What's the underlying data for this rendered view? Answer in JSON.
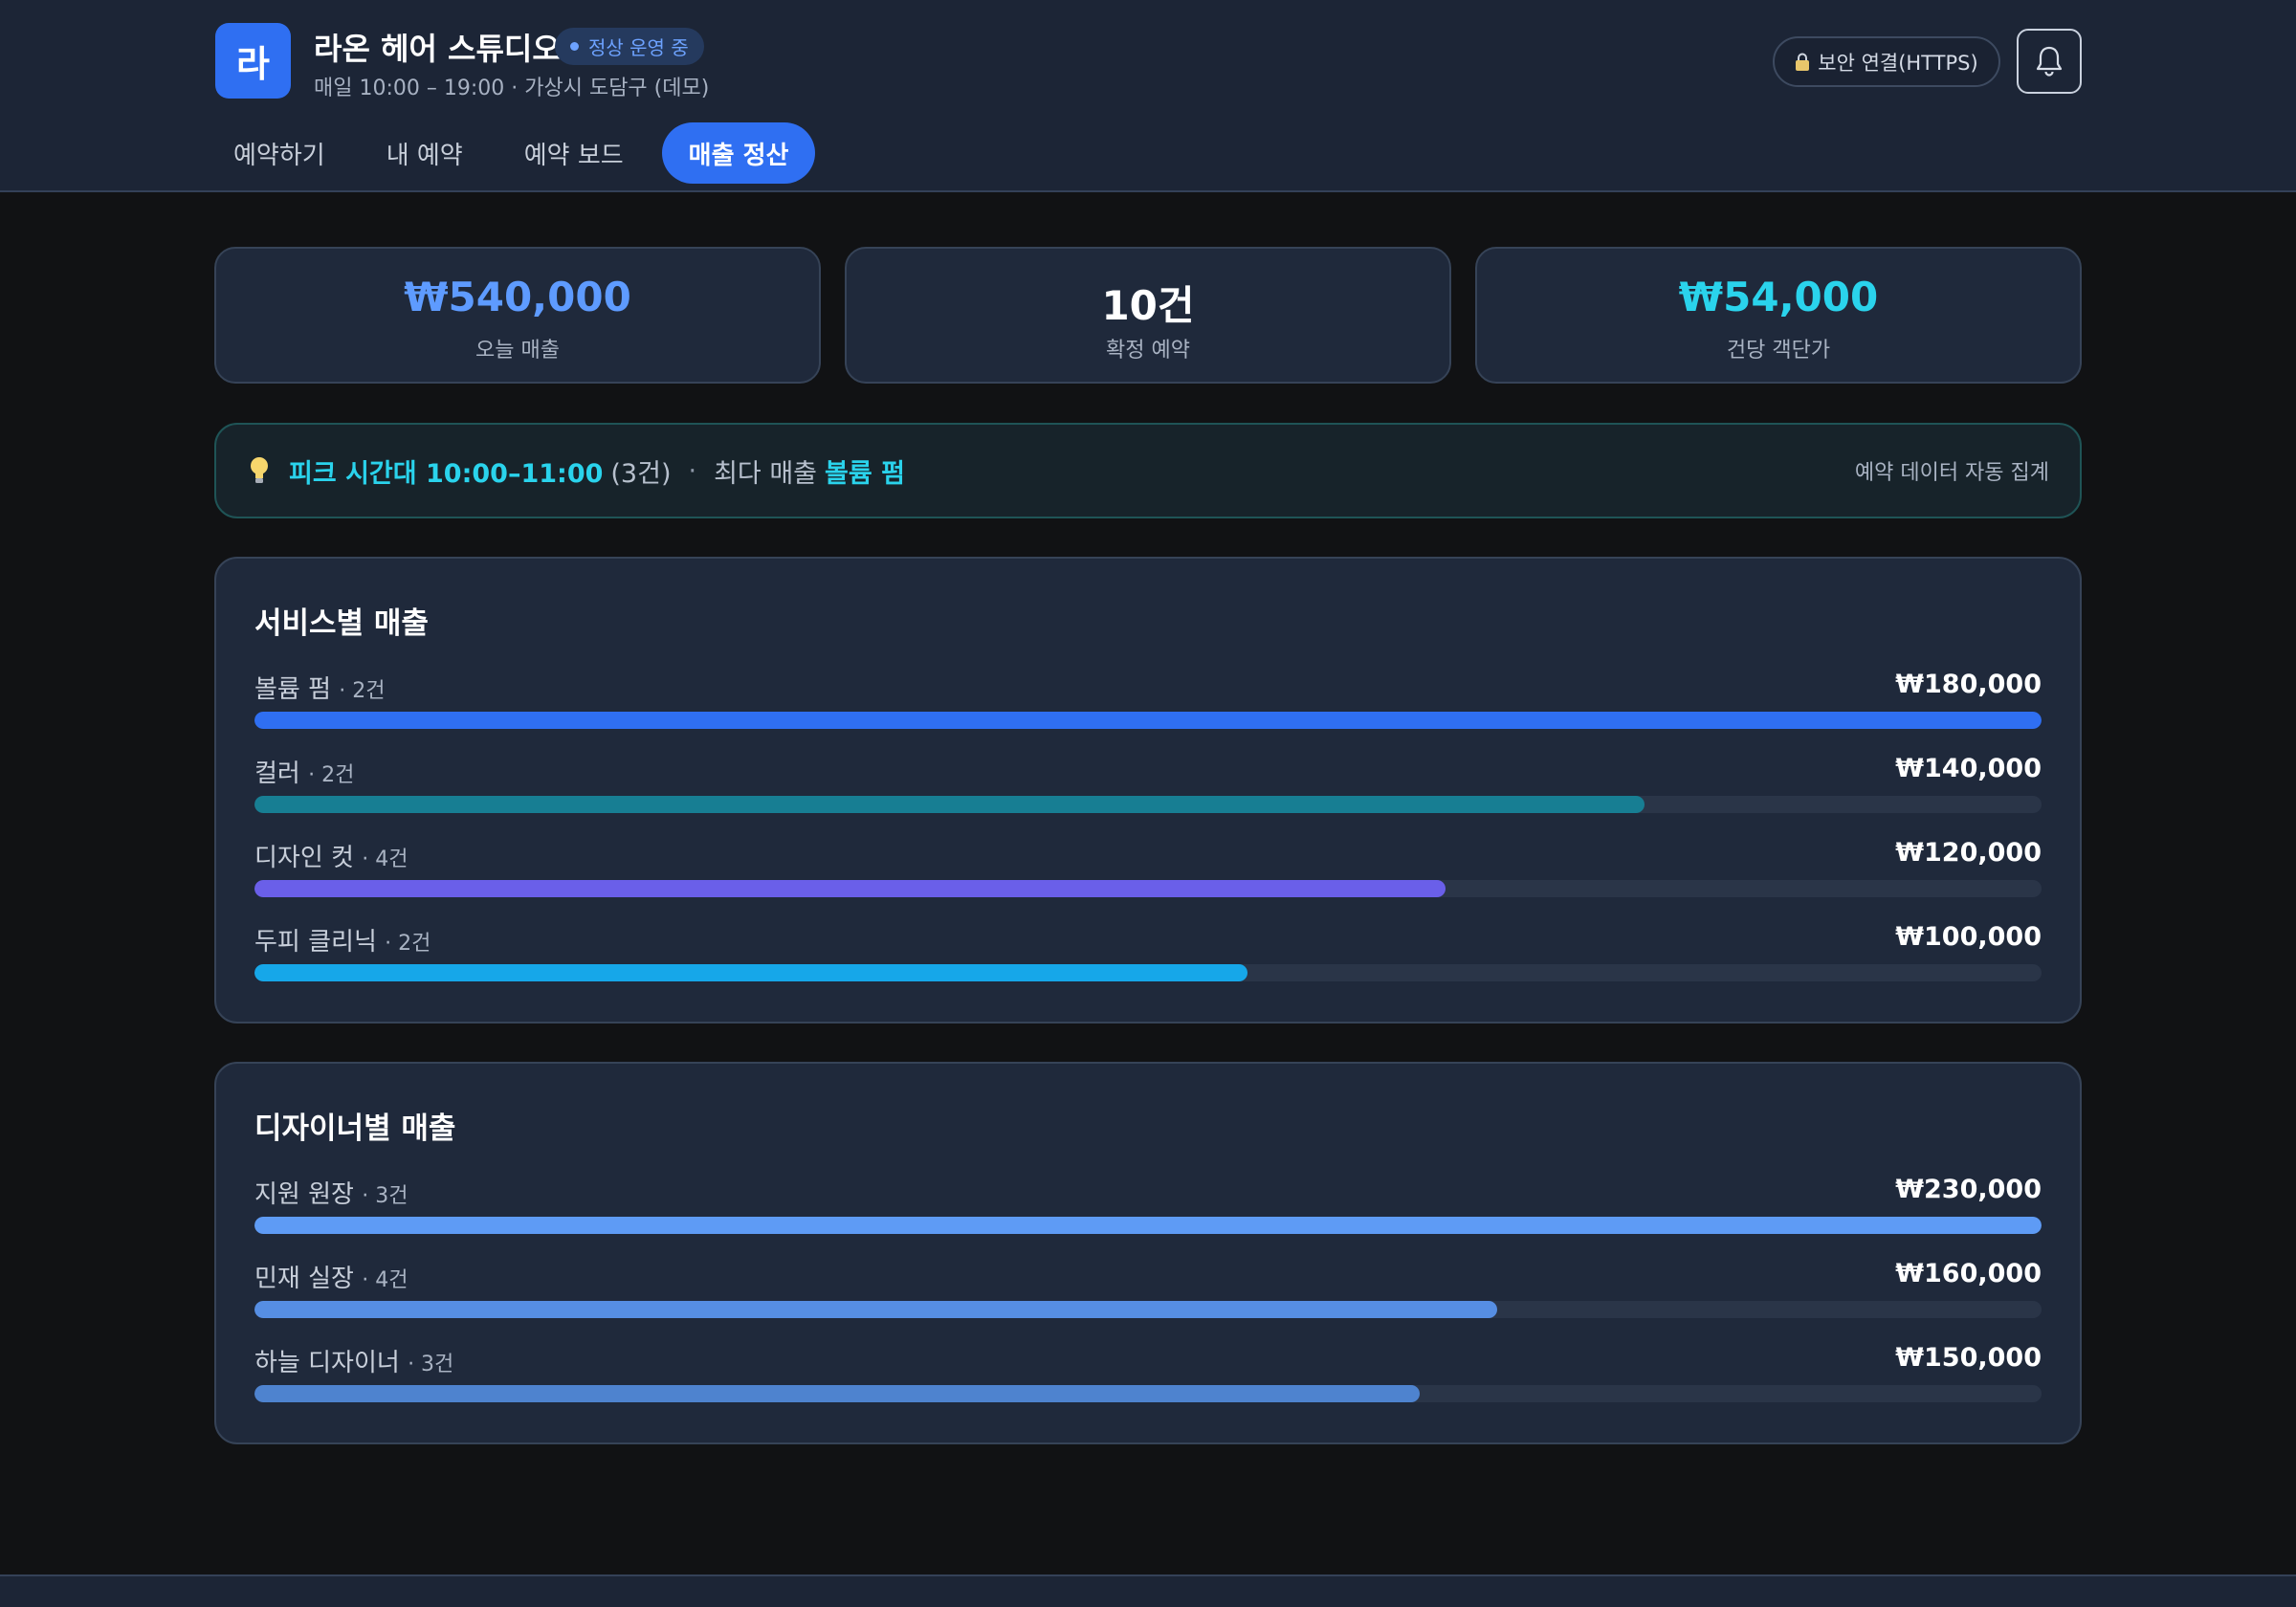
{
  "header": {
    "logo_text": "라",
    "title": "라온 헤어 스튜디오",
    "status": "정상 운영 중",
    "subtitle": "매일 10:00 – 19:00 · 가상시 도담구 (데모)",
    "security_label": "보안 연결(HTTPS)",
    "icons": {
      "lock": "lock-icon",
      "bell": "bell-icon"
    }
  },
  "tabs": [
    {
      "label": "예약하기",
      "active": false
    },
    {
      "label": "내 예약",
      "active": false
    },
    {
      "label": "예약 보드",
      "active": false
    },
    {
      "label": "매출 정산",
      "active": true
    }
  ],
  "stats": [
    {
      "value": "₩540,000",
      "label": "오늘 매출",
      "color": "#5e9bff"
    },
    {
      "value": "10건",
      "label": "확정 예약",
      "color": "#ffffff"
    },
    {
      "value": "₩54,000",
      "label": "건당 객단가",
      "color": "#2ad3ec"
    }
  ],
  "peak": {
    "icon": "lightbulb-icon",
    "time_text": "피크 시간대 10:00–11:00",
    "count_text": "(3건)",
    "separator": "·",
    "top_label": "최다 매출",
    "top_value": "볼륨 펌",
    "note": "예약 데이터 자동 집계"
  },
  "service_sales": {
    "title": "서비스별 매출",
    "items": [
      {
        "name": "볼륨 펌",
        "count": "· 2건",
        "amount": "₩180,000",
        "value": 180000,
        "color": "#2f6ff2"
      },
      {
        "name": "컬러",
        "count": "· 2건",
        "amount": "₩140,000",
        "value": 140000,
        "color": "#177e93"
      },
      {
        "name": "디자인 컷",
        "count": "· 4건",
        "amount": "₩120,000",
        "value": 120000,
        "color": "#6a5fe9"
      },
      {
        "name": "두피 클리닉",
        "count": "· 2건",
        "amount": "₩100,000",
        "value": 100000,
        "color": "#16a7e9"
      }
    ]
  },
  "designer_sales": {
    "title": "디자이너별 매출",
    "items": [
      {
        "name": "지원 원장",
        "count": "· 3건",
        "amount": "₩230,000",
        "value": 230000,
        "color": "#5e9bf5"
      },
      {
        "name": "민재 실장",
        "count": "· 4건",
        "amount": "₩160,000",
        "value": 160000,
        "color": "#568ee3"
      },
      {
        "name": "하늘 디자이너",
        "count": "· 3건",
        "amount": "₩150,000",
        "value": 150000,
        "color": "#4e83cf"
      }
    ]
  }
}
